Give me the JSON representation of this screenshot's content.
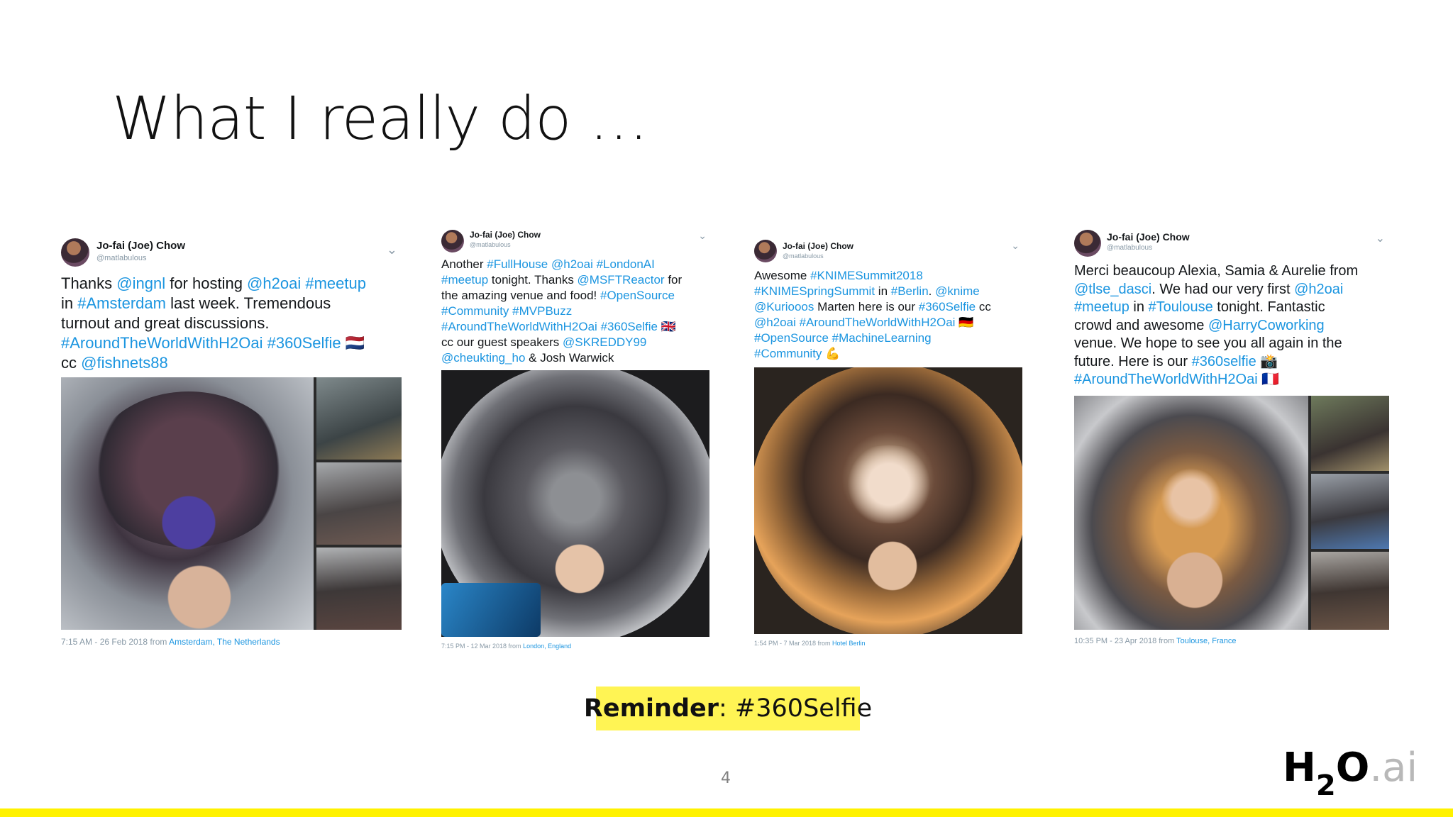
{
  "slide": {
    "title": "What I really do …",
    "reminder_label": "Reminder",
    "reminder_value": ": #360Selfie",
    "page_number": "4",
    "logo": {
      "h": "H",
      "two": "2",
      "o": "O",
      "ai": ".ai"
    },
    "accent_color": "#fff200"
  },
  "tweets": [
    {
      "name": "Jo-fai (Joe) Chow",
      "handle": "@matlabulous",
      "lines": [
        [
          [
            "Thanks ",
            0
          ],
          [
            "@ingnl",
            1
          ],
          [
            " for hosting ",
            0
          ],
          [
            "@h2oai",
            1
          ],
          [
            " ",
            0
          ],
          [
            "#meetup",
            1
          ]
        ],
        [
          [
            "in ",
            0
          ],
          [
            "#Amsterdam",
            1
          ],
          [
            " last week. Tremendous",
            0
          ]
        ],
        [
          [
            "turnout and great discussions.",
            0
          ]
        ],
        [
          [
            "#AroundTheWorldWithH2Oai",
            1
          ],
          [
            " ",
            0
          ],
          [
            "#360Selfie",
            1
          ],
          [
            " 🇳🇱",
            0
          ]
        ],
        [
          [
            "cc ",
            0
          ],
          [
            "@fishnets88",
            1
          ]
        ]
      ],
      "meta_time": "7:15 AM - 26 Feb 2018 from ",
      "meta_loc": "Amsterdam, The Netherlands"
    },
    {
      "name": "Jo-fai (Joe) Chow",
      "handle": "@matlabulous",
      "lines": [
        [
          [
            "Another ",
            0
          ],
          [
            "#FullHouse",
            1
          ],
          [
            " ",
            0
          ],
          [
            "@h2oai",
            1
          ],
          [
            " ",
            0
          ],
          [
            "#LondonAI",
            1
          ]
        ],
        [
          [
            "#meetup",
            1
          ],
          [
            " tonight. Thanks ",
            0
          ],
          [
            "@MSFTReactor",
            1
          ],
          [
            " for",
            0
          ]
        ],
        [
          [
            "the amazing venue and food! ",
            0
          ],
          [
            "#OpenSource",
            1
          ]
        ],
        [
          [
            "#Community",
            1
          ],
          [
            " ",
            0
          ],
          [
            "#MVPBuzz",
            1
          ]
        ],
        [
          [
            "#AroundTheWorldWithH2Oai",
            1
          ],
          [
            " ",
            0
          ],
          [
            "#360Selfie",
            1
          ],
          [
            " 🇬🇧",
            0
          ]
        ],
        [
          [
            "cc our guest speakers ",
            0
          ],
          [
            "@SKREDDY99",
            1
          ]
        ],
        [
          [
            "@cheukting_ho",
            1
          ],
          [
            " & Josh Warwick",
            0
          ]
        ]
      ],
      "meta_time": "7:15 PM - 12 Mar 2018 from ",
      "meta_loc": "London, England"
    },
    {
      "name": "Jo-fai (Joe) Chow",
      "handle": "@matlabulous",
      "lines": [
        [
          [
            "Awesome ",
            0
          ],
          [
            "#KNIMESummit2018",
            1
          ]
        ],
        [
          [
            "#KNIMESpringSummit",
            1
          ],
          [
            " in ",
            0
          ],
          [
            "#Berlin",
            1
          ],
          [
            ". ",
            0
          ],
          [
            "@knime",
            1
          ]
        ],
        [
          [
            "@Kuriooos",
            1
          ],
          [
            " Marten here is our ",
            0
          ],
          [
            "#360Selfie",
            1
          ],
          [
            " cc",
            0
          ]
        ],
        [
          [
            "@h2oai",
            1
          ],
          [
            " ",
            0
          ],
          [
            "#AroundTheWorldWithH2Oai",
            1
          ],
          [
            " 🇩🇪",
            0
          ]
        ],
        [
          [
            "#OpenSource",
            1
          ],
          [
            " ",
            0
          ],
          [
            "#MachineLearning",
            1
          ]
        ],
        [
          [
            "#Community",
            1
          ],
          [
            " 💪",
            0
          ]
        ]
      ],
      "meta_time": "1:54 PM - 7 Mar 2018 from ",
      "meta_loc": "Hotel Berlin"
    },
    {
      "name": "Jo-fai (Joe) Chow",
      "handle": "@matlabulous",
      "lines": [
        [
          [
            "Merci beaucoup Alexia, Samia & Aurelie from",
            0
          ]
        ],
        [
          [
            "@tlse_dasci",
            1
          ],
          [
            ". We had our very first ",
            0
          ],
          [
            "@h2oai",
            1
          ]
        ],
        [
          [
            "#meetup",
            1
          ],
          [
            " in ",
            0
          ],
          [
            "#Toulouse",
            1
          ],
          [
            " tonight. Fantastic",
            0
          ]
        ],
        [
          [
            "crowd and awesome ",
            0
          ],
          [
            "@HarryCoworking",
            1
          ]
        ],
        [
          [
            "venue. We hope to see you all again in the",
            0
          ]
        ],
        [
          [
            "future. Here is our ",
            0
          ],
          [
            "#360selfie",
            1
          ],
          [
            " 📸",
            0
          ]
        ],
        [
          [
            "#AroundTheWorldWithH2Oai",
            1
          ],
          [
            " 🇫🇷",
            0
          ]
        ]
      ],
      "meta_time": "10:35 PM - 23 Apr 2018 from ",
      "meta_loc": "Toulouse, France"
    }
  ]
}
